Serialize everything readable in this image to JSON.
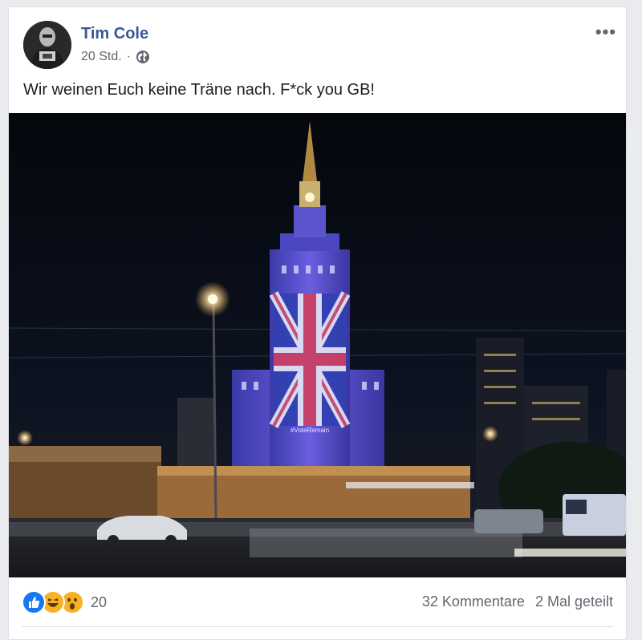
{
  "post": {
    "author": "Tim Cole",
    "time": "20 Std.",
    "separator": "·",
    "privacy_icon": "globe-icon",
    "more_icon": "more-options-icon",
    "more_label": "•••",
    "text": "Wir weinen Euch keine Träne nach. F*ck you GB!",
    "photo_caption_on_building": "#VoteRemain"
  },
  "footer": {
    "reactions": [
      {
        "icon": "like-icon",
        "color": "#1877f2"
      },
      {
        "icon": "haha-icon",
        "color": "#f7b125"
      },
      {
        "icon": "wow-icon",
        "color": "#f7b125"
      }
    ],
    "reaction_count": "20",
    "comments": "32 Kommentare",
    "shares": "2 Mal geteilt"
  },
  "colors": {
    "author_link": "#385898",
    "meta_text": "#606770",
    "body_text": "#1c1e21"
  }
}
